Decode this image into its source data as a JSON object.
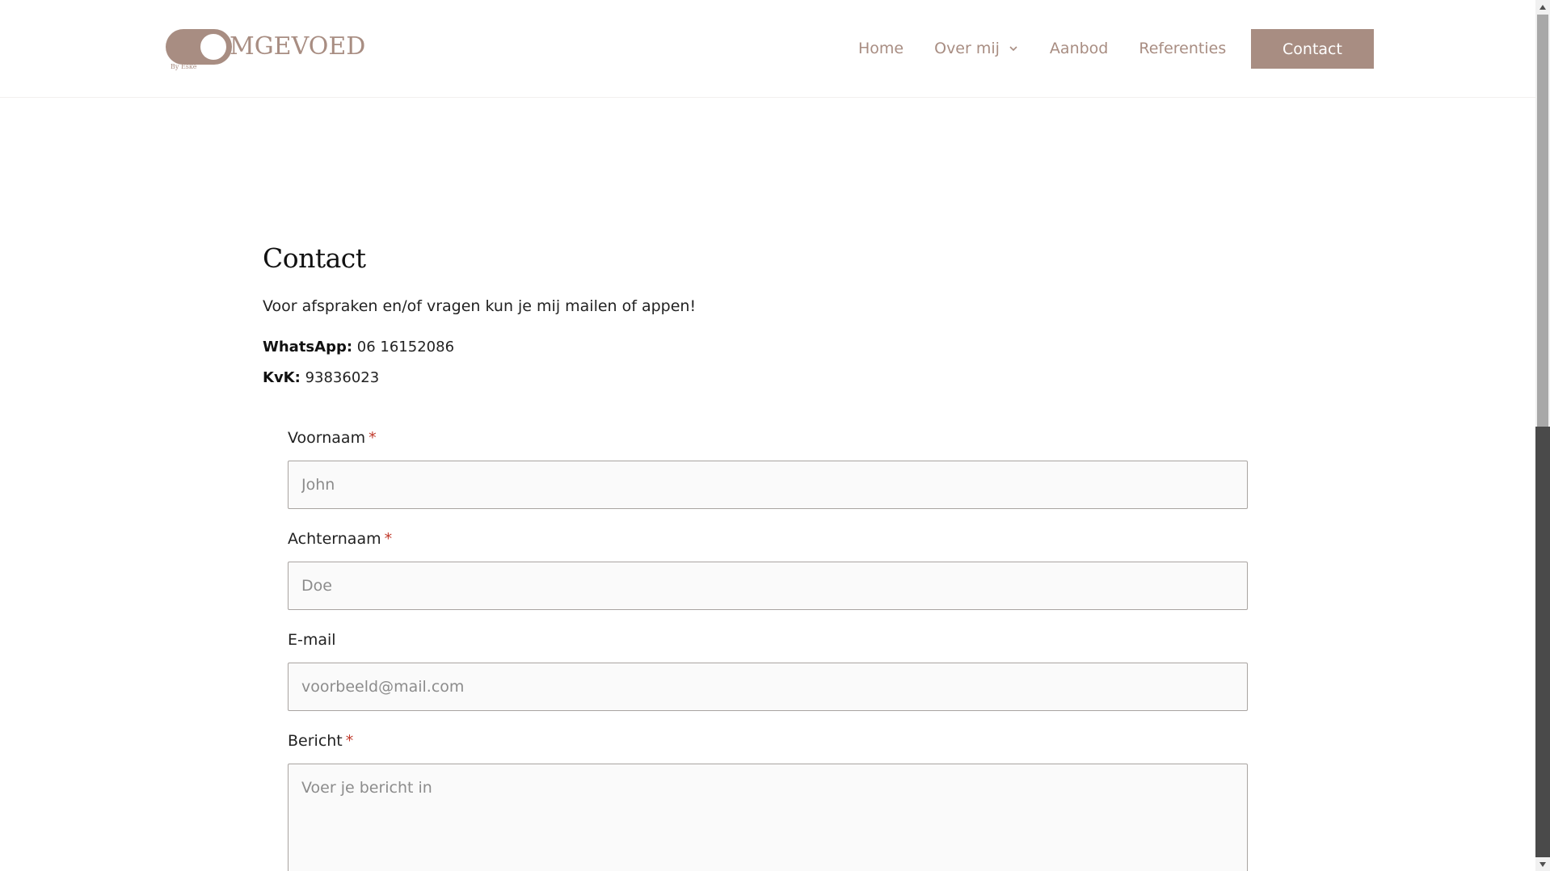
{
  "brand": {
    "logo_text": "MGEVOED",
    "logo_sub": "By Eske",
    "accent_color": "#a88d82"
  },
  "nav": {
    "items": [
      {
        "label": "Home"
      },
      {
        "label": "Over mij",
        "has_dropdown": true
      },
      {
        "label": "Aanbod"
      },
      {
        "label": "Referenties"
      }
    ],
    "cta_label": "Contact"
  },
  "main": {
    "title": "Contact",
    "intro": "Voor afspraken en/of vragen kun je mij mailen of appen!",
    "whatsapp_label": "WhatsApp:",
    "whatsapp_value": "06 16152086",
    "kvk_label": "KvK:",
    "kvk_value": "93836023"
  },
  "form": {
    "first_name": {
      "label": "Voornaam",
      "required_mark": "*",
      "placeholder": "John"
    },
    "last_name": {
      "label": "Achternaam",
      "required_mark": "*",
      "placeholder": "Doe"
    },
    "email": {
      "label": "E-mail",
      "placeholder": "voorbeeld@mail.com"
    },
    "message": {
      "label": "Bericht",
      "required_mark": "*",
      "placeholder": "Voer je bericht in"
    }
  }
}
